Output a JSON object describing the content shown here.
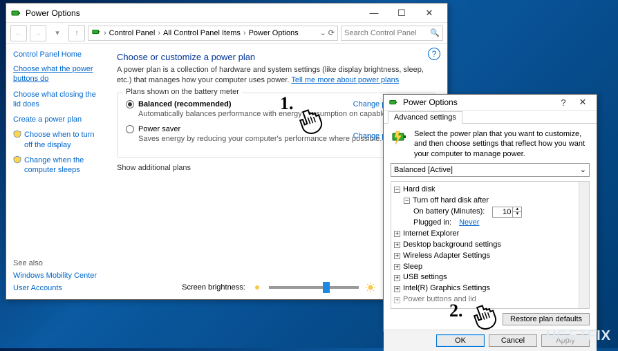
{
  "main_window": {
    "title": "Power Options",
    "breadcrumbs": [
      "Control Panel",
      "All Control Panel Items",
      "Power Options"
    ],
    "search_placeholder": "Search Control Panel",
    "sidebar": {
      "home": "Control Panel Home",
      "links": [
        "Choose what the power buttons do",
        "Choose what closing the lid does",
        "Create a power plan",
        "Choose when to turn off the display",
        "Change when the computer sleeps"
      ],
      "see_also_header": "See also",
      "see_also": [
        "Windows Mobility Center",
        "User Accounts"
      ]
    },
    "content": {
      "heading": "Choose or customize a power plan",
      "description": "A power plan is a collection of hardware and system settings (like display brightness, sleep, etc.) that manages how your computer uses power. ",
      "description_link": "Tell me more about power plans",
      "group_label": "Plans shown on the battery meter",
      "plans": [
        {
          "name": "Balanced (recommended)",
          "sub": "Automatically balances performance with energy consumption on capable hardware.",
          "checked": true,
          "link": "Change plan settings"
        },
        {
          "name": "Power saver",
          "sub": "Saves energy by reducing your computer's performance where possible.",
          "checked": false,
          "link": "Change plan settings"
        }
      ],
      "show_more": "Show additional plans",
      "brightness_label": "Screen brightness:"
    }
  },
  "dialog": {
    "title": "Power Options",
    "tab": "Advanced settings",
    "description": "Select the power plan that you want to customize, and then choose settings that reflect how you want your computer to manage power.",
    "combo_value": "Balanced [Active]",
    "tree": {
      "hard_disk": "Hard disk",
      "turn_off": "Turn off hard disk after",
      "on_battery_label": "On battery (Minutes):",
      "on_battery_value": "10",
      "plugged_in_label": "Plugged in:",
      "plugged_in_value": "Never",
      "others": [
        "Internet Explorer",
        "Desktop background settings",
        "Wireless Adapter Settings",
        "Sleep",
        "USB settings",
        "Intel(R) Graphics Settings",
        "Power buttons and lid"
      ]
    },
    "restore": "Restore plan defaults",
    "buttons": {
      "ok": "OK",
      "cancel": "Cancel",
      "apply": "Apply"
    }
  },
  "annotations": {
    "n1": "1.",
    "n2": "2."
  },
  "watermark": {
    "a": "U",
    "b": "GET",
    "c": "FIX"
  }
}
